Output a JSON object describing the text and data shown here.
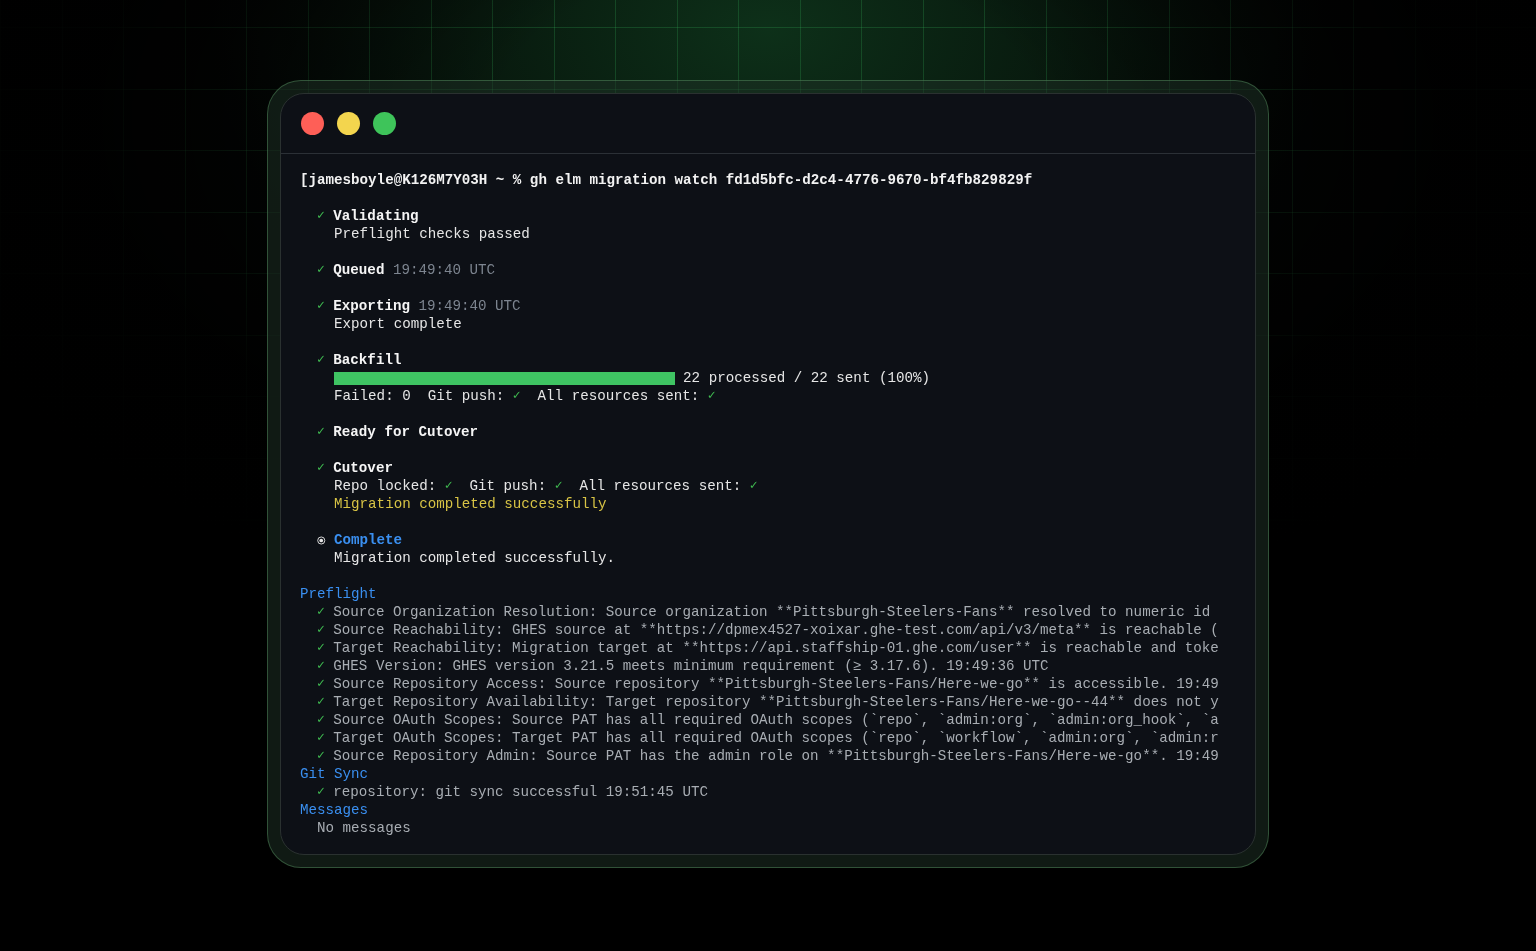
{
  "window": {
    "buttons": [
      {
        "kind": "close"
      },
      {
        "kind": "minimize"
      },
      {
        "kind": "zoom"
      }
    ]
  },
  "prompt": "[jamesboyle@K126M7Y03H ~ % gh elm migration watch fd1d5bfc-d2c4-4776-9670-bf4fb829829f",
  "steps": [
    {
      "done": true,
      "mark": "✓",
      "title": "Validating",
      "lines": [
        {
          "kind": "plain",
          "text": "Preflight checks passed"
        }
      ]
    },
    {
      "done": true,
      "mark": "✓",
      "title": "Queued",
      "time": "19:49:40 UTC"
    },
    {
      "done": true,
      "mark": "✓",
      "title": "Exporting",
      "time": "19:49:40 UTC",
      "lines": [
        {
          "kind": "plain",
          "text": "Export complete"
        }
      ]
    },
    {
      "done": true,
      "mark": "✓",
      "title": "Backfill",
      "lines": [
        {
          "kind": "progress",
          "level": 1,
          "reading": "22 processed / 22 sent (100%)"
        },
        {
          "kind": "status",
          "items": [
            {
              "label": "Failed: 0"
            },
            {
              "label": "Git push:",
              "check": "✓"
            },
            {
              "label": "All resources sent:",
              "check": "✓"
            }
          ]
        }
      ]
    },
    {
      "done": true,
      "mark": "✓",
      "title": "Ready for Cutover"
    },
    {
      "done": true,
      "mark": "✓",
      "title": "Cutover",
      "lines": [
        {
          "kind": "status",
          "items": [
            {
              "label": "Repo locked:",
              "check": "✓"
            },
            {
              "label": "Git push:",
              "check": "✓"
            },
            {
              "label": "All resources sent:",
              "check": "✓"
            }
          ]
        },
        {
          "kind": "success",
          "text": "Migration completed successfully"
        }
      ]
    },
    {
      "done": false,
      "title": "Complete",
      "lines": [
        {
          "kind": "plain",
          "text": "Migration completed successfully."
        }
      ]
    }
  ],
  "sections": [
    {
      "title": "Preflight",
      "items": [
        {
          "check": "✓",
          "text": "Source Organization Resolution: Source organization **Pittsburgh-Steelers-Fans** resolved to numeric id"
        },
        {
          "check": "✓",
          "text": "Source Reachability: GHES source at **https://dpmex4527-xoixar.ghe-test.com/api/v3/meta** is reachable ("
        },
        {
          "check": "✓",
          "text": "Target Reachability: Migration target at **https://api.staffship-01.ghe.com/user** is reachable and toke"
        },
        {
          "check": "✓",
          "text": "GHES Version: GHES version 3.21.5 meets minimum requirement (≥ 3.17.6). 19:49:36 UTC"
        },
        {
          "check": "✓",
          "text": "Source Repository Access: Source repository **Pittsburgh-Steelers-Fans/Here-we-go** is accessible. 19:49"
        },
        {
          "check": "✓",
          "text": "Target Repository Availability: Target repository **Pittsburgh-Steelers-Fans/Here-we-go--44** does not y"
        },
        {
          "check": "✓",
          "text": "Source OAuth Scopes: Source PAT has all required OAuth scopes (`repo`, `admin:org`, `admin:org_hook`, `a"
        },
        {
          "check": "✓",
          "text": "Target OAuth Scopes: Target PAT has all required OAuth scopes (`repo`, `workflow`, `admin:org`, `admin:r"
        },
        {
          "check": "✓",
          "text": "Source Repository Admin: Source PAT has the admin role on **Pittsburgh-Steelers-Fans/Here-we-go**. 19:49"
        }
      ]
    },
    {
      "title": "Git Sync",
      "items": [
        {
          "check": "✓",
          "text": "repository: git sync successful 19:51:45 UTC"
        }
      ]
    },
    {
      "title": "Messages",
      "items": [
        {
          "text": "No messages"
        }
      ]
    }
  ]
}
